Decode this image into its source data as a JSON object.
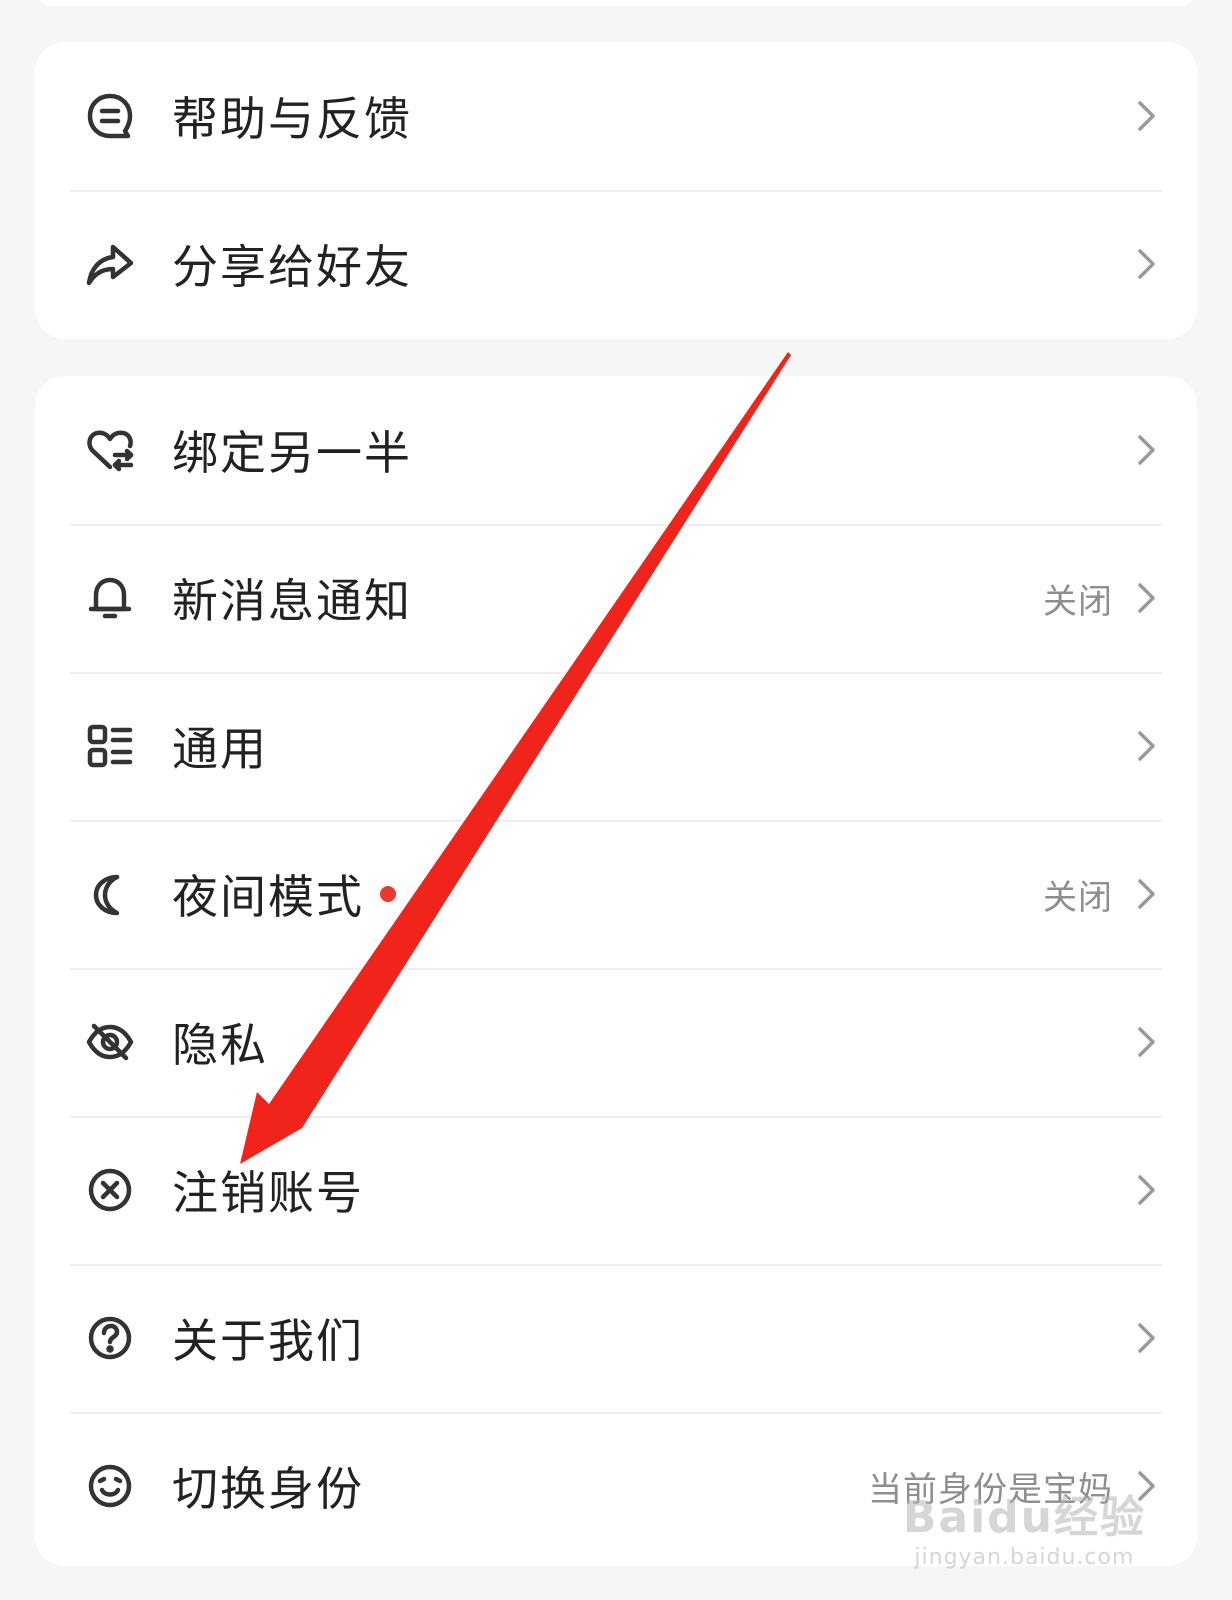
{
  "group1": [
    {
      "id": "help",
      "label": "帮助与反馈",
      "icon": "feedback-icon",
      "value": ""
    },
    {
      "id": "share",
      "label": "分享给好友",
      "icon": "share-icon",
      "value": ""
    }
  ],
  "group2": [
    {
      "id": "bind",
      "label": "绑定另一半",
      "icon": "heart-bind-icon",
      "value": ""
    },
    {
      "id": "notify",
      "label": "新消息通知",
      "icon": "bell-icon",
      "value": "关闭"
    },
    {
      "id": "general",
      "label": "通用",
      "icon": "list-grid-icon",
      "value": ""
    },
    {
      "id": "night",
      "label": "夜间模式",
      "icon": "moon-icon",
      "value": "关闭",
      "badge": true
    },
    {
      "id": "privacy",
      "label": "隐私",
      "icon": "eye-off-icon",
      "value": ""
    },
    {
      "id": "deactivate",
      "label": "注销账号",
      "icon": "close-circle-icon",
      "value": ""
    },
    {
      "id": "about",
      "label": "关于我们",
      "icon": "question-circle-icon",
      "value": ""
    },
    {
      "id": "switch",
      "label": "切换身份",
      "icon": "face-icon",
      "value": "当前身份是宝妈"
    }
  ],
  "colors": {
    "badge": "#e63b2e",
    "annotation_arrow": "#f0241a"
  },
  "watermark": {
    "logo": "Baidu经验",
    "url": "jingyan.baidu.com"
  }
}
